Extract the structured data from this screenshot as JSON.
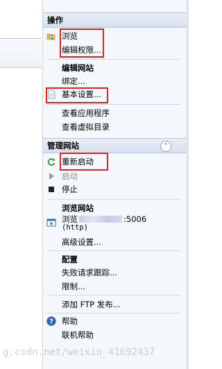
{
  "actions_header": "操作",
  "actions": {
    "browse": "浏览",
    "edit_permissions": "编辑权限..."
  },
  "edit_site": {
    "title": "编辑网站",
    "bindings": "绑定...",
    "basic_settings": "基本设置...",
    "view_applications": "查看应用程序",
    "view_virtual_dirs": "查看虚拟目录"
  },
  "manage_site": {
    "header": "管理网站",
    "restart": "重新启动",
    "start": "启动",
    "stop": "停止"
  },
  "browse_site": {
    "title": "浏览网站",
    "browse_prefix": "浏览",
    "port_suffix": ":5006",
    "protocol": "(http)",
    "advanced_settings": "高级设置..."
  },
  "configure": {
    "title": "配置",
    "failed_request_tracing": "失败请求跟踪...",
    "limits": "限制..."
  },
  "ftp": {
    "add_ftp_publishing": "添加 FTP 发布..."
  },
  "help": {
    "help": "帮助",
    "online_help": "联机帮助"
  },
  "watermark": "g.csdn.net/weixin_41692437",
  "colors": {
    "annotation_red": "#e2231a",
    "header_gradient": "#d6e0ee",
    "pane_bg": "#f4f7fb",
    "disabled_text": "#8c8c8c"
  },
  "icons": {
    "browse": "folder-search-icon",
    "basic_settings": "document-icon",
    "restart": "restart-icon",
    "start": "play-icon",
    "stop": "stop-icon",
    "browse_site": "browser-window-icon",
    "help": "help-icon",
    "collapse": "chevron-up-icon"
  }
}
